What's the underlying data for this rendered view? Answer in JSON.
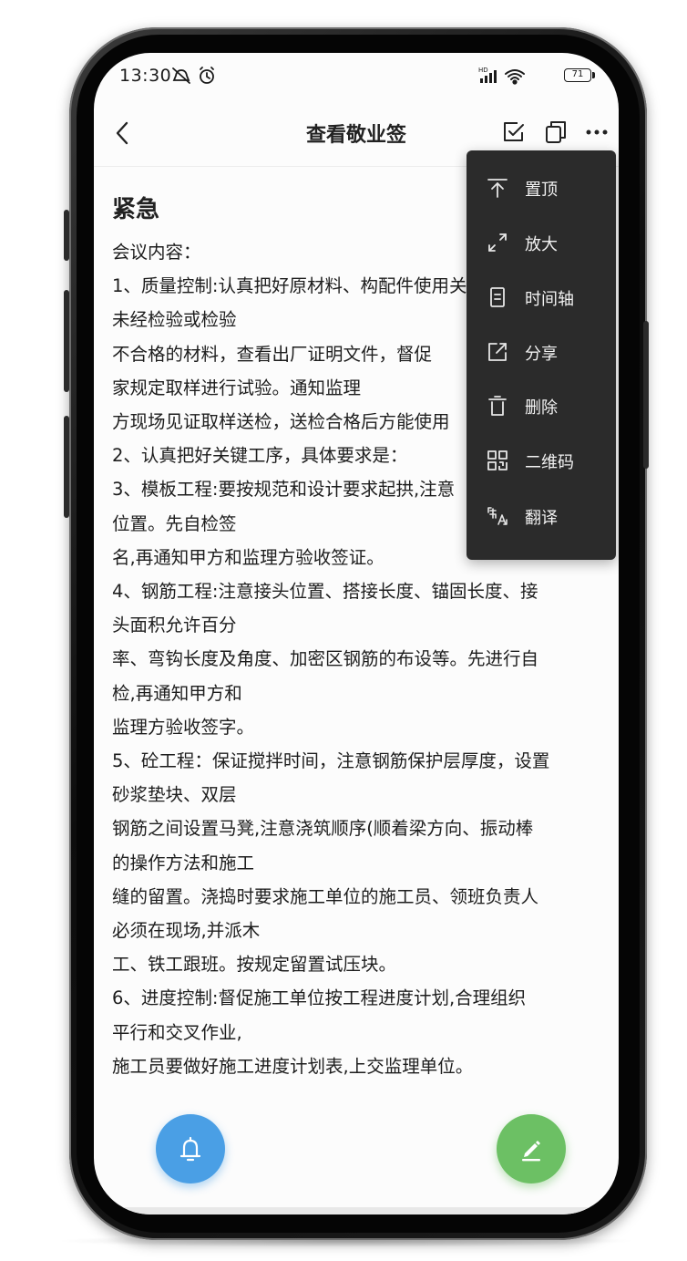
{
  "status_bar": {
    "time": "13:30",
    "battery": "71",
    "network": "HD"
  },
  "header": {
    "title": "查看敬业签"
  },
  "note": {
    "heading": "紧急",
    "lines": [
      "会议内容：",
      "1、质量控制:认真把好原材料、构配件使用关,",
      "未经检验或检验",
      "不合格的材料，查看出厂证明文件，督促",
      "家规定取样进行试验。通知监理",
      "方现场见证取样送检，送检合格后方能使用",
      "2、认真把好关键工序，具体要求是：",
      "3、模板工程:要按规范和设计要求起拱,注意",
      "位置。先自检签",
      "名,再通知甲方和监理方验收签证。",
      "4、钢筋工程:注意接头位置、搭接长度、锚固长度、接",
      "头面积允许百分",
      "率、弯钩长度及角度、加密区钢筋的布设等。先进行自",
      "检,再通知甲方和",
      "监理方验收签字。",
      "5、砼工程：保证搅拌时间，注意钢筋保护层厚度，设置",
      "砂浆垫块、双层",
      "钢筋之间设置马凳,注意浇筑顺序(顺着梁方向、振动棒",
      "的操作方法和施工",
      "缝的留置。浇捣时要求施工单位的施工员、领班负责人",
      "必须在现场,并派木",
      "工、铁工跟班。按规定留置试压块。",
      "6、进度控制:督促施工单位按工程进度计划,合理组织",
      "平行和交叉作业,",
      "施工员要做好施工进度计划表,上交监理单位。"
    ]
  },
  "menu": {
    "items": [
      {
        "label": "置顶",
        "icon": "pin-top-icon"
      },
      {
        "label": "放大",
        "icon": "expand-icon"
      },
      {
        "label": "时间轴",
        "icon": "timeline-icon"
      },
      {
        "label": "分享",
        "icon": "share-icon"
      },
      {
        "label": "删除",
        "icon": "trash-icon"
      },
      {
        "label": "二维码",
        "icon": "qr-code-icon"
      },
      {
        "label": "翻译",
        "icon": "translate-icon"
      }
    ]
  },
  "colors": {
    "menu_bg": "#2b2b2b",
    "bell_fab": "#4a9fe5",
    "edit_fab": "#6cc064"
  }
}
